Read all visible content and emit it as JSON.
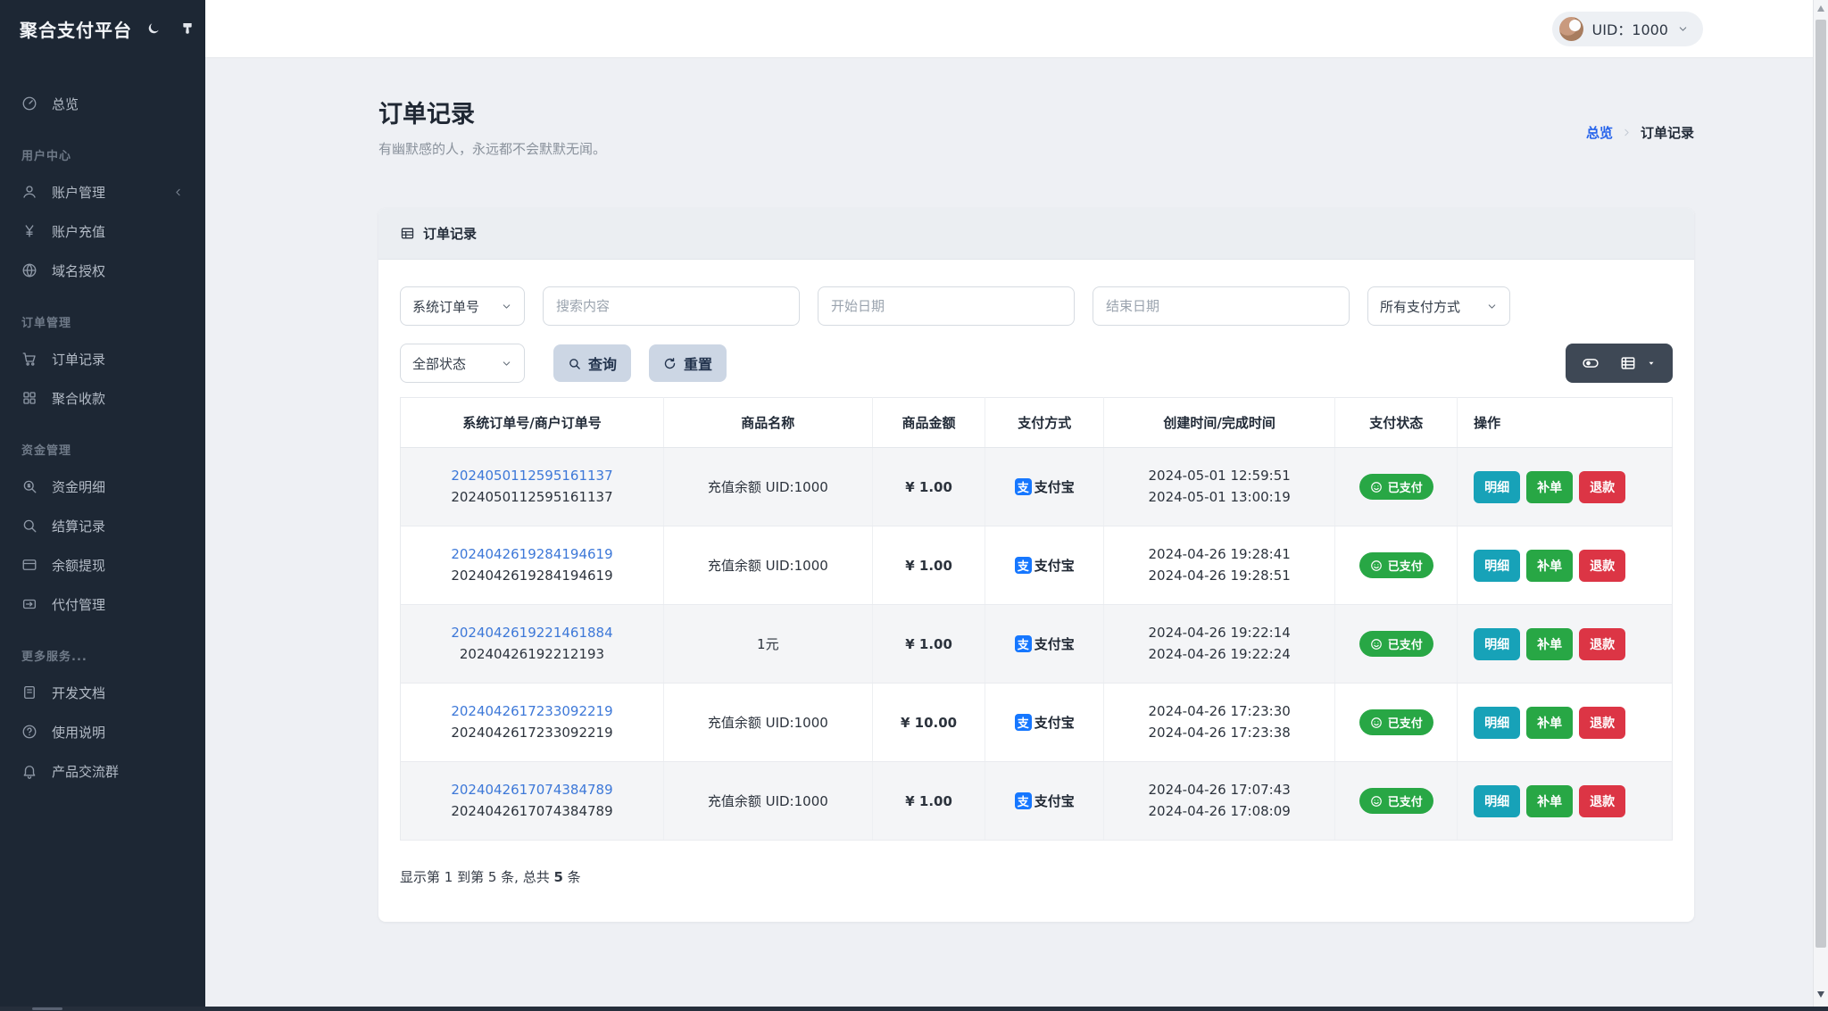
{
  "brand": {
    "title": "聚合支付平台"
  },
  "topbar": {
    "uid": "UID：1000"
  },
  "breadcrumb": {
    "home": "总览",
    "current": "订单记录"
  },
  "page": {
    "title": "订单记录",
    "subtitle": "有幽默感的人，永远都不会默默无闻。"
  },
  "sidebar": {
    "overview": "总览",
    "groups": [
      {
        "label": "用户中心",
        "items": [
          {
            "label": "账户管理"
          },
          {
            "label": "账户充值"
          },
          {
            "label": "域名授权"
          }
        ]
      },
      {
        "label": "订单管理",
        "items": [
          {
            "label": "订单记录"
          },
          {
            "label": "聚合收款"
          }
        ]
      },
      {
        "label": "资金管理",
        "items": [
          {
            "label": "资金明细"
          },
          {
            "label": "结算记录"
          },
          {
            "label": "余额提现"
          },
          {
            "label": "代付管理"
          }
        ]
      },
      {
        "label": "更多服务...",
        "items": [
          {
            "label": "开发文档"
          },
          {
            "label": "使用说明"
          },
          {
            "label": "产品交流群"
          }
        ]
      }
    ]
  },
  "card": {
    "title": "订单记录",
    "filters": {
      "order_type": "系统订单号",
      "search_placeholder": "搜索内容",
      "start_date_placeholder": "开始日期",
      "end_date_placeholder": "结束日期",
      "pay_method": "所有支付方式",
      "status": "全部状态",
      "query": "查询",
      "reset": "重置"
    },
    "table": {
      "headers": [
        "系统订单号/商户订单号",
        "商品名称",
        "商品金额",
        "支付方式",
        "创建时间/完成时间",
        "支付状态",
        "操作"
      ],
      "pay_icon_char": "支",
      "actions": {
        "detail": "明细",
        "reorder": "补单",
        "refund": "退款"
      },
      "rows": [
        {
          "system_no": "2024050112595161137",
          "merchant_no": "2024050112595161137",
          "product": "充值余额 UID:1000",
          "amount": "¥ 1.00",
          "method": "支付宝",
          "created": "2024-05-01 12:59:51",
          "completed": "2024-05-01 13:00:19",
          "status": "已支付"
        },
        {
          "system_no": "2024042619284194619",
          "merchant_no": "2024042619284194619",
          "product": "充值余额 UID:1000",
          "amount": "¥ 1.00",
          "method": "支付宝",
          "created": "2024-04-26 19:28:41",
          "completed": "2024-04-26 19:28:51",
          "status": "已支付"
        },
        {
          "system_no": "2024042619221461884",
          "merchant_no": "20240426192212193",
          "product": "1元",
          "amount": "¥ 1.00",
          "method": "支付宝",
          "created": "2024-04-26 19:22:14",
          "completed": "2024-04-26 19:22:24",
          "status": "已支付"
        },
        {
          "system_no": "2024042617233092219",
          "merchant_no": "2024042617233092219",
          "product": "充值余额 UID:1000",
          "amount": "¥ 10.00",
          "method": "支付宝",
          "created": "2024-04-26 17:23:30",
          "completed": "2024-04-26 17:23:38",
          "status": "已支付"
        },
        {
          "system_no": "2024042617074384789",
          "merchant_no": "2024042617074384789",
          "product": "充值余额 UID:1000",
          "amount": "¥ 1.00",
          "method": "支付宝",
          "created": "2024-04-26 17:07:43",
          "completed": "2024-04-26 17:08:09",
          "status": "已支付"
        }
      ]
    },
    "footer": {
      "prefix": "显示第 1 到第 5 条, 总共 ",
      "bold": "5",
      "suffix": " 条"
    }
  },
  "colors": {
    "sidebar_bg": "#1d2734",
    "accent_blue": "#2563eb",
    "link_blue": "#3d78d8",
    "success_green": "#28a745",
    "info_teal": "#17a2b8",
    "danger_red": "#dc3545",
    "alipay_blue": "#1677ff"
  }
}
